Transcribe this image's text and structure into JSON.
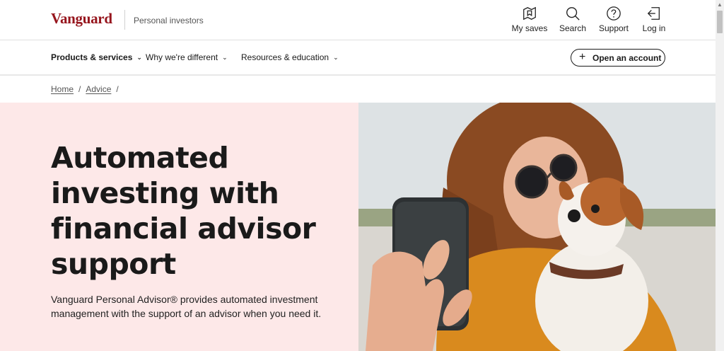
{
  "header": {
    "logo": "Vanguard",
    "audience": "Personal investors",
    "utilities": [
      {
        "label": "My saves",
        "icon": "bookmark-map-icon"
      },
      {
        "label": "Search",
        "icon": "search-icon"
      },
      {
        "label": "Support",
        "icon": "help-circle-icon"
      },
      {
        "label": "Log in",
        "icon": "login-icon"
      }
    ]
  },
  "nav": {
    "items": [
      {
        "label": "Products & services",
        "icon": "chevron-down-icon"
      },
      {
        "label": "Why we're different",
        "icon": "chevron-down-icon"
      },
      {
        "label": "Resources & education",
        "icon": "chevron-down-icon"
      }
    ],
    "cta": "Open an account"
  },
  "breadcrumb": {
    "items": [
      "Home",
      "Advice"
    ],
    "separator": "/"
  },
  "hero": {
    "title_lines": [
      "Automated",
      "investing with",
      "financial advisor",
      "support"
    ],
    "subtitle": "Vanguard Personal Advisor® provides automated investment management with the support of an advisor when you need it.",
    "image_icon": "photo-woman-selfie-with-dog"
  },
  "colors": {
    "brand": "#96151d",
    "hero_bg": "#fde8e8",
    "text": "#1a1a1a"
  }
}
